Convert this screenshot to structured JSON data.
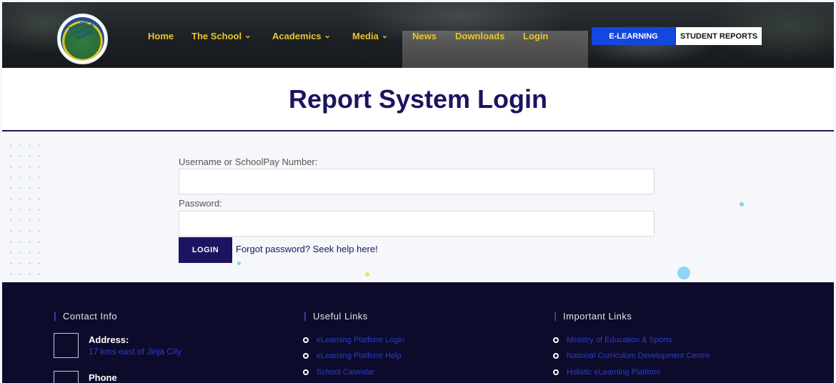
{
  "header": {
    "logo_text": "BUSOGA COLLEGE MWIRI",
    "nav": [
      {
        "label": "Home",
        "has_menu": false
      },
      {
        "label": "The School",
        "has_menu": true
      },
      {
        "label": "Academics",
        "has_menu": true
      },
      {
        "label": "Media",
        "has_menu": true
      },
      {
        "label": "News",
        "has_menu": false
      },
      {
        "label": "Downloads",
        "has_menu": false
      },
      {
        "label": "Login",
        "has_menu": false
      }
    ],
    "elearning_label": "E-LEARNING",
    "reports_label": "STUDENT REPORTS"
  },
  "page_title": "Report System Login",
  "form": {
    "username_label": "Username or SchoolPay Number:",
    "username_value": "",
    "password_label": "Password:",
    "password_value": "",
    "login_label": "LOGIN",
    "forgot_label": "Forgot password? Seek help here!"
  },
  "footer": {
    "contact": {
      "heading": "Contact Info",
      "address_title": "Address:",
      "address_value": "17 kms east of Jinja City",
      "phone_title": "Phone"
    },
    "useful": {
      "heading": "Useful Links",
      "items": [
        "eLearning Platform Login",
        "eLearning Platform Help",
        "School Calendar"
      ]
    },
    "important": {
      "heading": "Important Links",
      "items": [
        "Ministry of Education & Sports",
        "National Curriculum Development Centre",
        "Holistic eLearning Platform"
      ]
    }
  },
  "colors": {
    "brand_navy": "#1b1460",
    "nav_gold": "#e8c528",
    "elearning_blue": "#1347e0",
    "footer_bg": "#0d0b2b",
    "footer_link": "#2a3dd0"
  }
}
